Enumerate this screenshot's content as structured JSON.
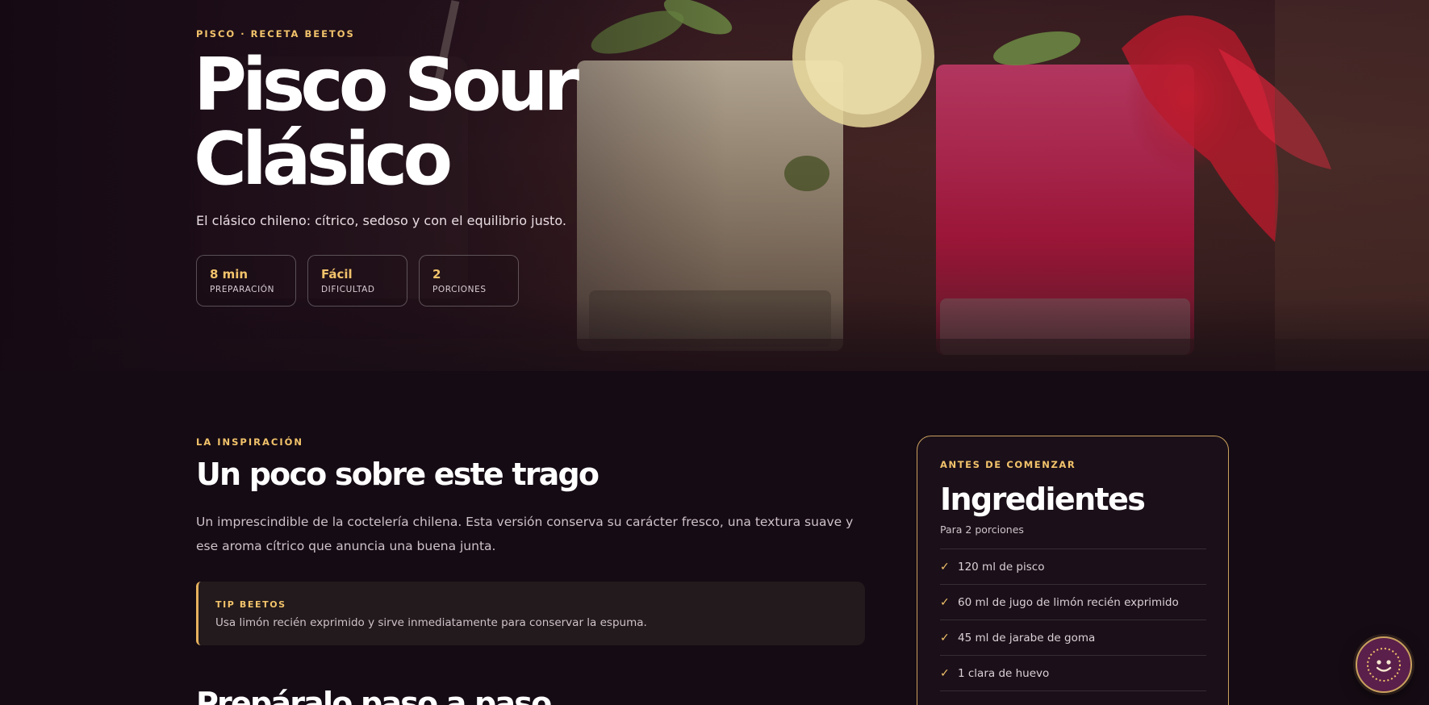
{
  "hero": {
    "eyebrow": "PISCO · RECETA BEETOS",
    "title_line1": "Pisco Sour",
    "title_line2": "Clásico",
    "subtitle": "El clásico chileno: cítrico, sedoso y con el equilibrio justo.",
    "background_image": "cocktail-glasses-photo",
    "stats": [
      {
        "value": "8 min",
        "label": "PREPARACIÓN"
      },
      {
        "value": "Fácil",
        "label": "DIFICULTAD"
      },
      {
        "value": "2",
        "label": "PORCIONES"
      }
    ]
  },
  "inspiration": {
    "eyebrow": "LA INSPIRACIÓN",
    "title": "Un poco sobre este trago",
    "text": "Un imprescindible de la coctelería chilena. Esta versión conserva su carácter fresco, una textura suave y ese aroma cítrico que anuncia una buena junta.",
    "tip": {
      "title": "TIP BEETOS",
      "text": "Usa limón recién exprimido y sirve inmediatamente para conservar la espuma."
    }
  },
  "steps": {
    "title": "Prepáralo paso a paso"
  },
  "ingredients": {
    "eyebrow": "ANTES DE COMENZAR",
    "title": "Ingredientes",
    "subtitle": "Para 2 porciones",
    "check_icon": "✓",
    "items": [
      "120 ml de pisco",
      "60 ml de jugo de limón recién exprimido",
      "45 ml de jarabe de goma",
      "1 clara de huevo"
    ]
  },
  "chat": {
    "icon": "smiley-face-icon"
  },
  "colors": {
    "background": "#150b14",
    "accent": "#f2c36b",
    "card_border": "#c9a05e",
    "tip_background": "#221a1c",
    "bubble": "#5a1f4a"
  }
}
